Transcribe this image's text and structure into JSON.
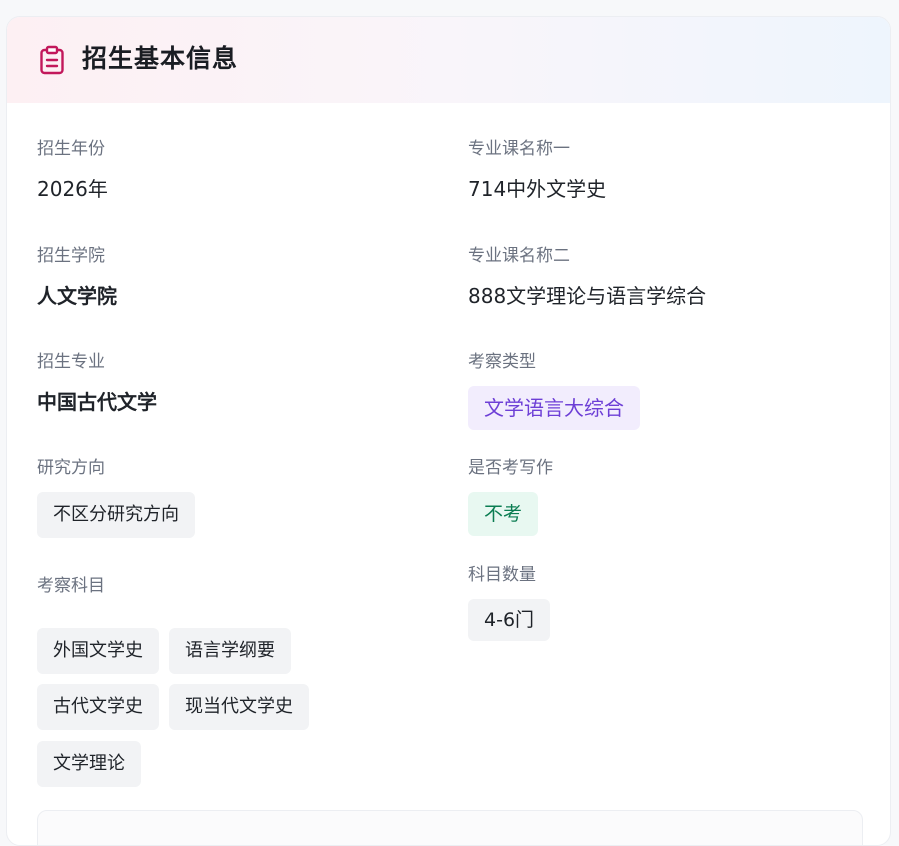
{
  "header": {
    "title": "招生基本信息",
    "icon": "clipboard-icon",
    "icon_color": "#c2185b"
  },
  "left": {
    "year": {
      "label": "招生年份",
      "value": "2026年"
    },
    "college": {
      "label": "招生学院",
      "value": "人文学院"
    },
    "major": {
      "label": "招生专业",
      "value": "中国古代文学"
    },
    "direction": {
      "label": "研究方向",
      "value": "不区分研究方向"
    },
    "subjects": {
      "label": "考察科目",
      "items": [
        "外国文学史",
        "语言学纲要",
        "古代文学史",
        "现当代文学史",
        "文学理论"
      ]
    }
  },
  "right": {
    "course1": {
      "label": "专业课名称一",
      "value": "714中外文学史"
    },
    "course2": {
      "label": "专业课名称二",
      "value": "888文学理论与语言学综合"
    },
    "exam_type": {
      "label": "考察类型",
      "value": "文学语言大综合",
      "color": "#6d3fd6"
    },
    "writing": {
      "label": "是否考写作",
      "value": "不考",
      "color": "#0b7d52"
    },
    "subject_count": {
      "label": "科目数量",
      "value": "4-6门"
    }
  }
}
